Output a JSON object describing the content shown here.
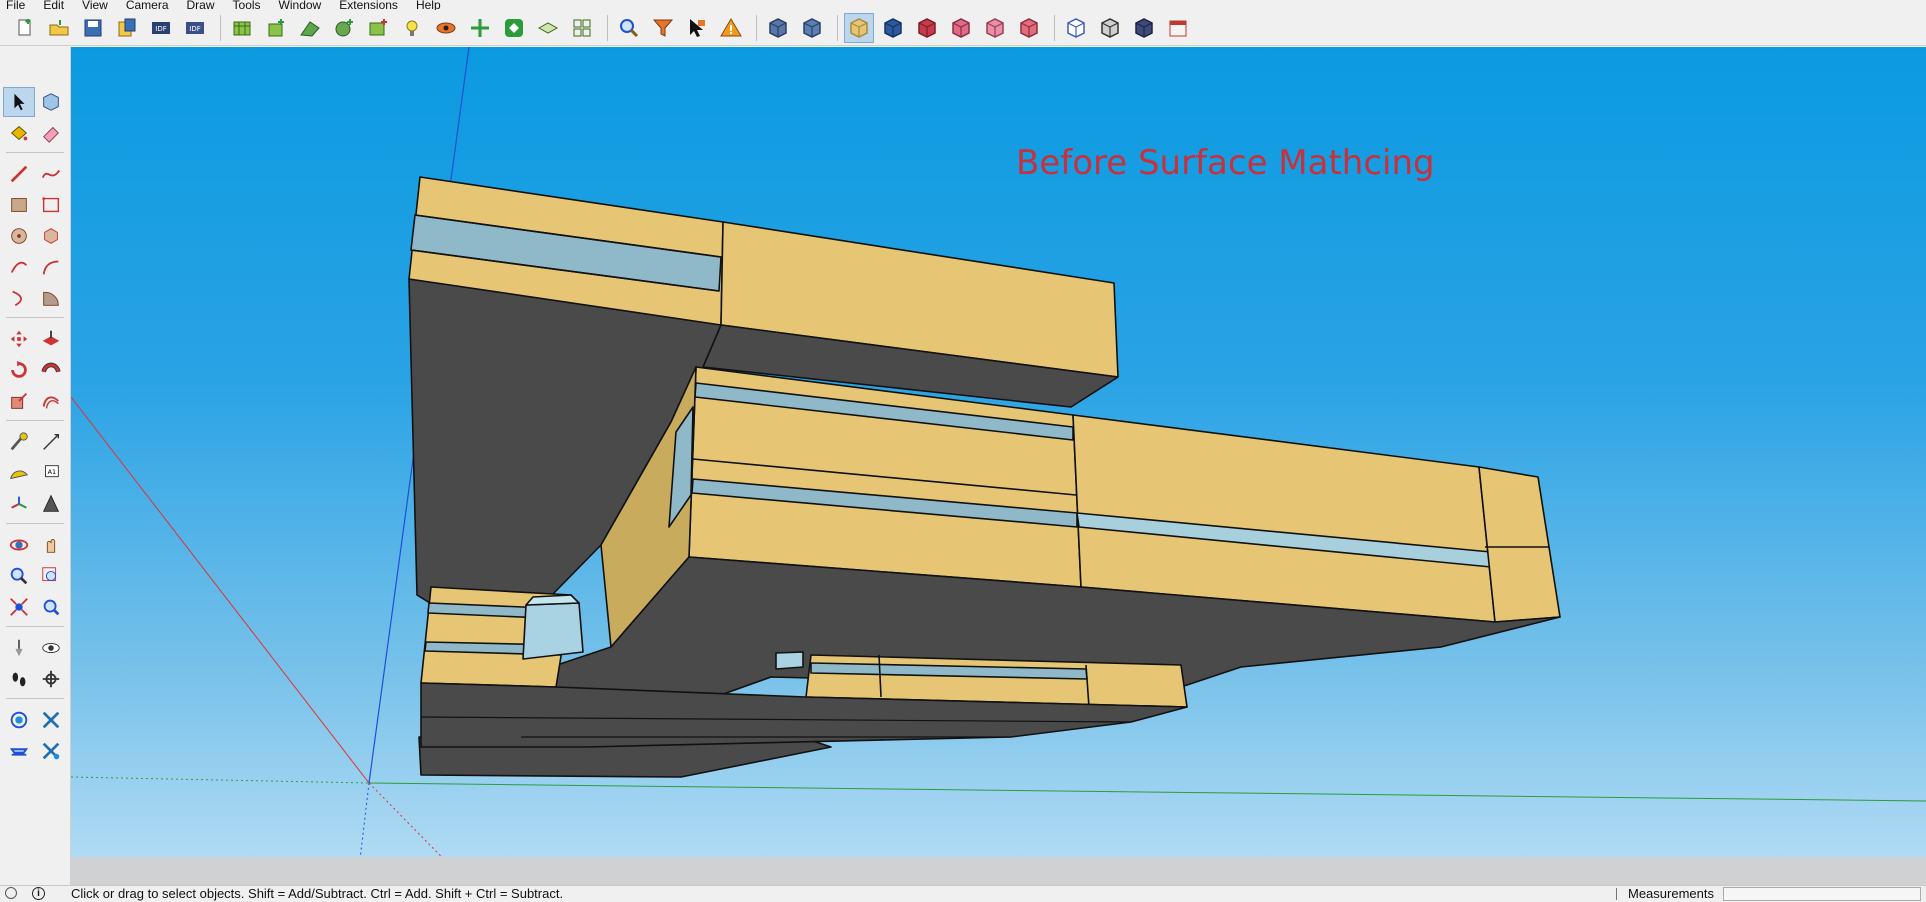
{
  "menu": [
    "File",
    "Edit",
    "View",
    "Camera",
    "Draw",
    "Tools",
    "Window",
    "Extensions",
    "Help"
  ],
  "toolbar_top": {
    "groups": [
      [
        "new-file",
        "open",
        "save",
        "save-as",
        "idf-import",
        "idf-export"
      ],
      [
        "space-add",
        "zone-add",
        "surface-add",
        "thermal-zone",
        "space-type",
        "light",
        "eye",
        "arrows",
        "recycle",
        "layers",
        "grid"
      ],
      [
        "search",
        "filter",
        "cursor-pick",
        "warning"
      ],
      [
        "cube-blue",
        "help-cube"
      ],
      [
        "box-tan",
        "box-blue",
        "box-red",
        "box-pink",
        "box-pink2",
        "box-pink3"
      ],
      [
        "cube-wire",
        "cube-grid",
        "cube-dark",
        "calendar"
      ]
    ],
    "active": "box-tan"
  },
  "toolbar_left": {
    "rows": [
      [
        "select",
        "component"
      ],
      [
        "paint-bucket",
        "eraser"
      ],
      [
        "line",
        "freehand"
      ],
      [
        "rectangle",
        "rotated-rectangle"
      ],
      [
        "circle",
        "polygon"
      ],
      [
        "arc",
        "two-point-arc"
      ],
      [
        "three-point-arc",
        "pie"
      ],
      [
        "move",
        "push-pull"
      ],
      [
        "rotate",
        "follow-me"
      ],
      [
        "scale",
        "offset"
      ],
      [
        "tape-measure",
        "dimension"
      ],
      [
        "protractor",
        "text"
      ],
      [
        "axes",
        "3d-text"
      ],
      [
        "orbit",
        "pan"
      ],
      [
        "zoom",
        "zoom-window"
      ],
      [
        "zoom-extents",
        "previous"
      ],
      [
        "position-camera",
        "look-around"
      ],
      [
        "walk",
        "section-plane"
      ],
      [
        "sandbox-1",
        "sandbox-2"
      ],
      [
        "sandbox-3",
        "sandbox-4"
      ]
    ],
    "separators_after": [
      1,
      6,
      9,
      12,
      15,
      17
    ],
    "active": "select"
  },
  "viewport": {
    "annotation": "Before Surface Mathcing",
    "colors": {
      "sky_top": "#0b9ae0",
      "sky_bottom": "#b8def5",
      "face_tan": "#e6c675",
      "face_dark": "#4a4a4a",
      "glass": "#8fb9c9",
      "axis_red": "#d33",
      "axis_green": "#2a9d3a",
      "axis_blue": "#1f4ed8"
    }
  },
  "status": {
    "hint": "Click or drag to select objects. Shift = Add/Subtract. Ctrl = Add. Shift + Ctrl = Subtract.",
    "measurements_label": "Measurements",
    "measurements_value": ""
  }
}
